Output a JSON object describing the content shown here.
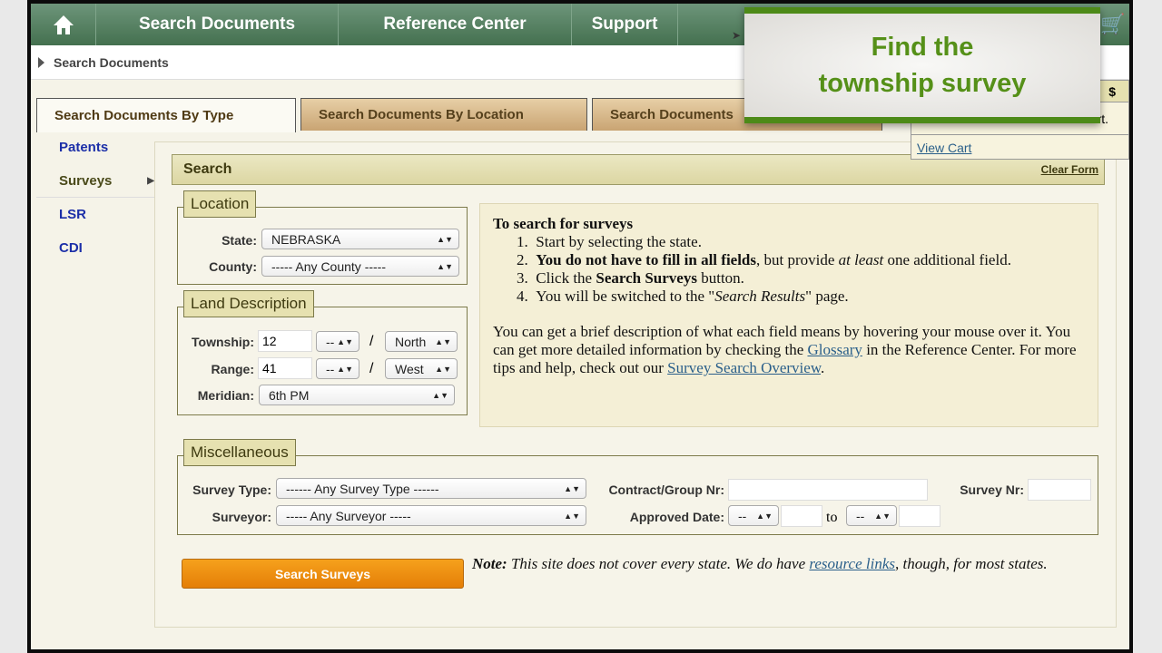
{
  "nav": {
    "home_icon": "home-icon",
    "items": [
      "Search Documents",
      "Reference Center",
      "Support"
    ],
    "cart_icon": "shopping-cart-icon"
  },
  "breadcrumb": "Search Documents",
  "tabs": [
    "Search Documents By Type",
    "Search Documents By Location",
    "Search Documents"
  ],
  "sidebar": [
    {
      "label": "Patents"
    },
    {
      "label": "Surveys",
      "active": true
    },
    {
      "label": "LSR"
    },
    {
      "label": "CDI"
    }
  ],
  "search": {
    "title": "Search",
    "clear": "Clear Form"
  },
  "location": {
    "legend": "Location",
    "state_label": "State:",
    "state": "NEBRASKA",
    "county_label": "County:",
    "county": "----- Any County -----"
  },
  "land": {
    "legend": "Land Description",
    "township_label": "Township:",
    "township": "12",
    "township_dir_mod": "--",
    "township_dir": "North",
    "range_label": "Range:",
    "range": "41",
    "range_dir_mod": "--",
    "range_dir": "West",
    "slash": "/",
    "meridian_label": "Meridian:",
    "meridian": "6th PM"
  },
  "info": {
    "title": "To search for surveys",
    "steps": [
      "Start by selecting the state.",
      "field.",
      "Click the ",
      "You will be switched to the \""
    ],
    "step2_bold": "You do not have to fill in all fields",
    "step2_mid": ", but provide ",
    "step2_em": "at least",
    "step2_end": " one additional",
    "step3_bold": "Search Surveys",
    "step3_end": " button.",
    "step4_em": "Search Results",
    "step4_end": "\" page.",
    "p1": "You can get a brief description of what each field means by hovering your mouse over it. You can get more detailed information by checking the ",
    "glossary": "Glossary",
    "p2": " in the Reference Center. For more tips and help, check out our ",
    "overview": "Survey Search Overview",
    "p3": "."
  },
  "misc": {
    "legend": "Miscellaneous",
    "survey_type_label": "Survey Type:",
    "survey_type": "------ Any Survey Type ------",
    "surveyor_label": "Surveyor:",
    "surveyor": "----- Any Surveyor -----",
    "contract_label": "Contract/Group Nr:",
    "survey_nr_label": "Survey Nr:",
    "approved_label": "Approved Date:",
    "date_from": "--",
    "to": "to",
    "date_to": "--"
  },
  "search_button": "Search Surveys",
  "note": {
    "label": "Note:",
    "text": " This site does not cover every state. We do have ",
    "link": "resource links",
    "end": ", though, for most states."
  },
  "cart": {
    "header": "$",
    "partial": "rt.",
    "view": "View Cart"
  },
  "overlay": {
    "line1": "Find the",
    "line2": "township survey"
  },
  "colors": {
    "nav": "#44704f",
    "accent": "#4d8a18",
    "button": "#e47e07"
  }
}
